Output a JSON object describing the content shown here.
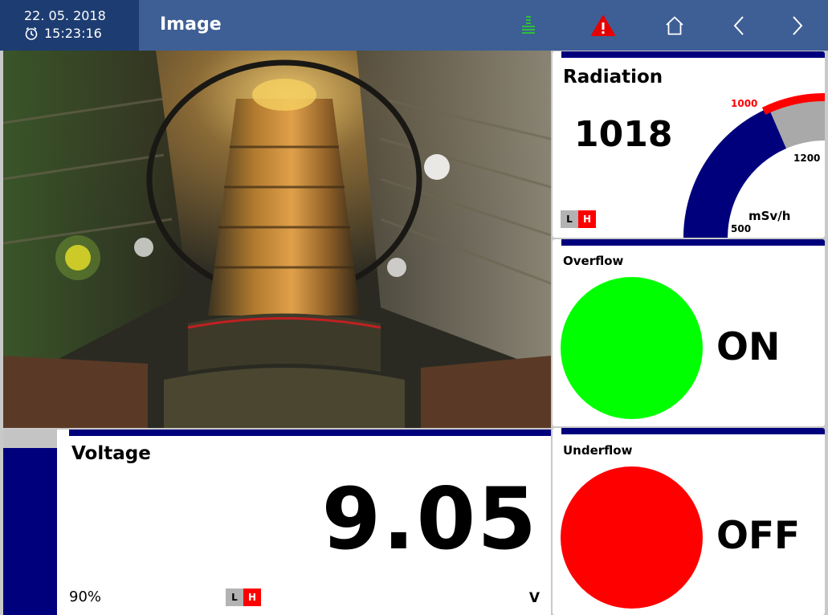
{
  "header": {
    "date": "22. 05. 2018",
    "time": "15:23:16",
    "title": "Image",
    "icons": [
      "list-icon",
      "warning-icon",
      "home-icon",
      "chevron-left-icon",
      "chevron-right-icon"
    ],
    "colors": {
      "bar": "#3e5f95",
      "datetime_bg": "#1d3d72",
      "list_icon": "#2dbf3a",
      "warning_icon": "#e60000"
    }
  },
  "radiation": {
    "title": "Radiation",
    "value": "1018",
    "unit": "mSv/h",
    "gauge": {
      "min": 500,
      "max": 1200,
      "threshold": 1000,
      "value": 1018,
      "min_label": "500",
      "max_label": "1200",
      "threshold_label": "1000"
    },
    "limits": {
      "low": "L",
      "high": "H"
    }
  },
  "overflow": {
    "title": "Overflow",
    "state": "ON",
    "color": "#00ff00"
  },
  "underflow": {
    "title": "Underflow",
    "state": "OFF",
    "color": "#ff0000"
  },
  "voltage": {
    "title": "Voltage",
    "value": "9.05",
    "unit": "V",
    "percent_label": "90%",
    "level": 0.9,
    "limits": {
      "low": "L",
      "high": "H"
    }
  }
}
